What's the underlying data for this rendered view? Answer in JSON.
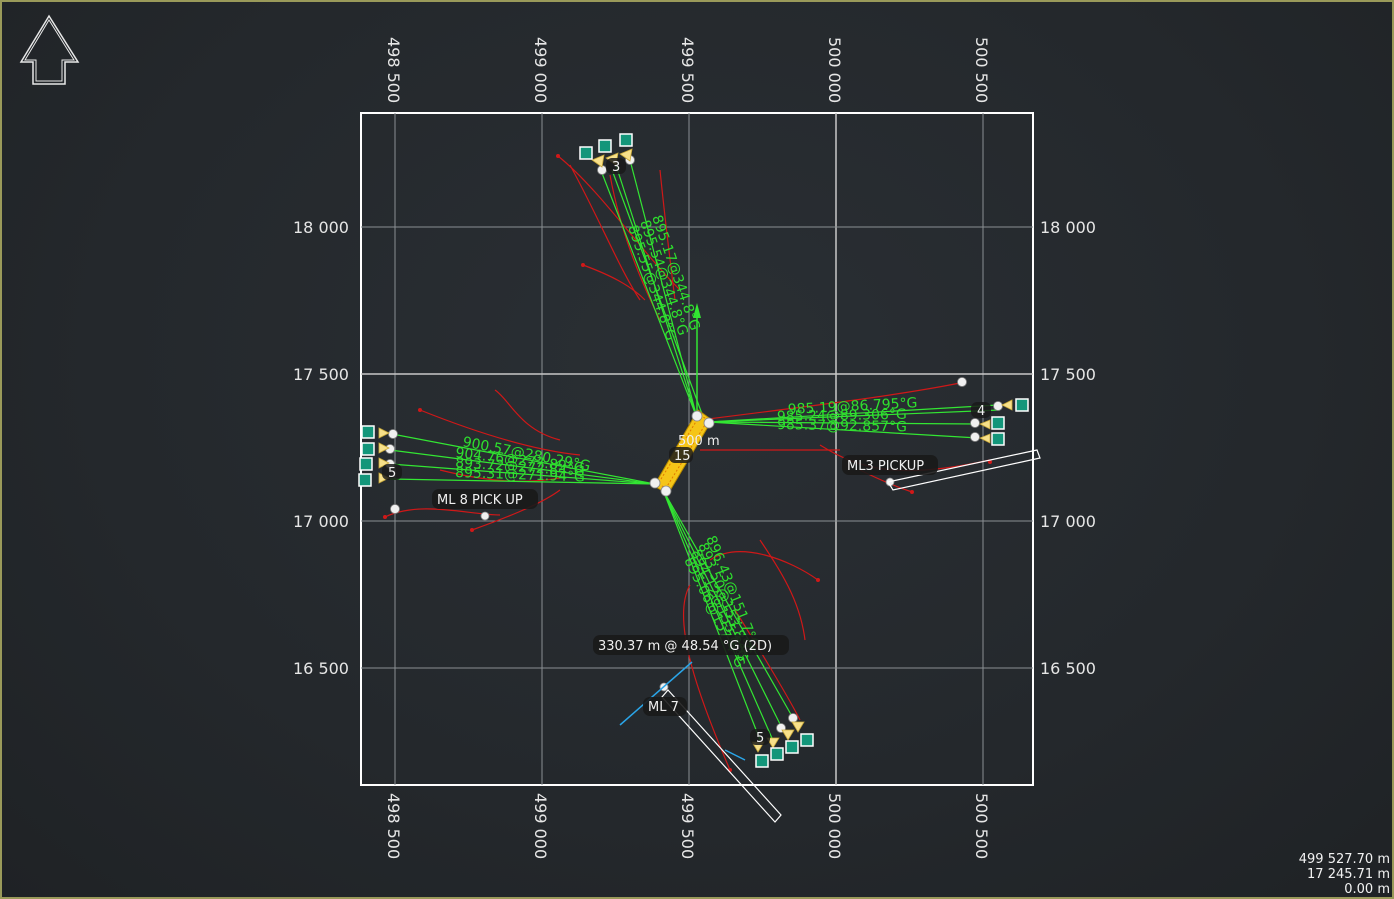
{
  "grid": {
    "x_ticks": [
      "498 500",
      "499 000",
      "499 500",
      "500 000",
      "500 500"
    ],
    "y_ticks": [
      "18 000",
      "17 500",
      "17 000",
      "16 500"
    ]
  },
  "center": {
    "scale_label": "500 m",
    "count_badge": "15"
  },
  "spreads": {
    "north": {
      "badge": "3",
      "labels": [
        "895.17@344.8°G",
        "895.54@344.8°G",
        "895.55@344.8°G"
      ]
    },
    "east": {
      "badge": "4",
      "labels": [
        "985.19@86.795°G",
        "985.24@89.306°G",
        "985.37@92.857°G"
      ]
    },
    "west": {
      "badge": "5",
      "labels": [
        "900.57@280.29°G",
        "904.76@277.89°G",
        "893.72@272.84°G",
        "895.31@271.94°G"
      ]
    },
    "south": {
      "badge": "5",
      "labels": [
        "896.43@151.7°G",
        "893.50@153.8°G",
        "894.12@155.8°G",
        "895.06@157.4°G"
      ]
    }
  },
  "pickups": {
    "ml8": "ML 8 PICK UP",
    "ml3": "ML3 PICKUP",
    "ml7": "ML 7"
  },
  "measurement": "330.37 m @ 48.54 °G (2D)",
  "readout": {
    "x": "499 527.70 m",
    "y": "17 245.71 m",
    "z": "0.00 m"
  },
  "colors": {
    "grid": "#bdbdbd",
    "frame": "#ffffff",
    "spread_line": "#33e633",
    "track": "#d01818",
    "node": "#13967a",
    "vessel": "#f5c518",
    "measure": "#2aa5e8"
  },
  "icons": [
    "north-arrow-icon"
  ]
}
